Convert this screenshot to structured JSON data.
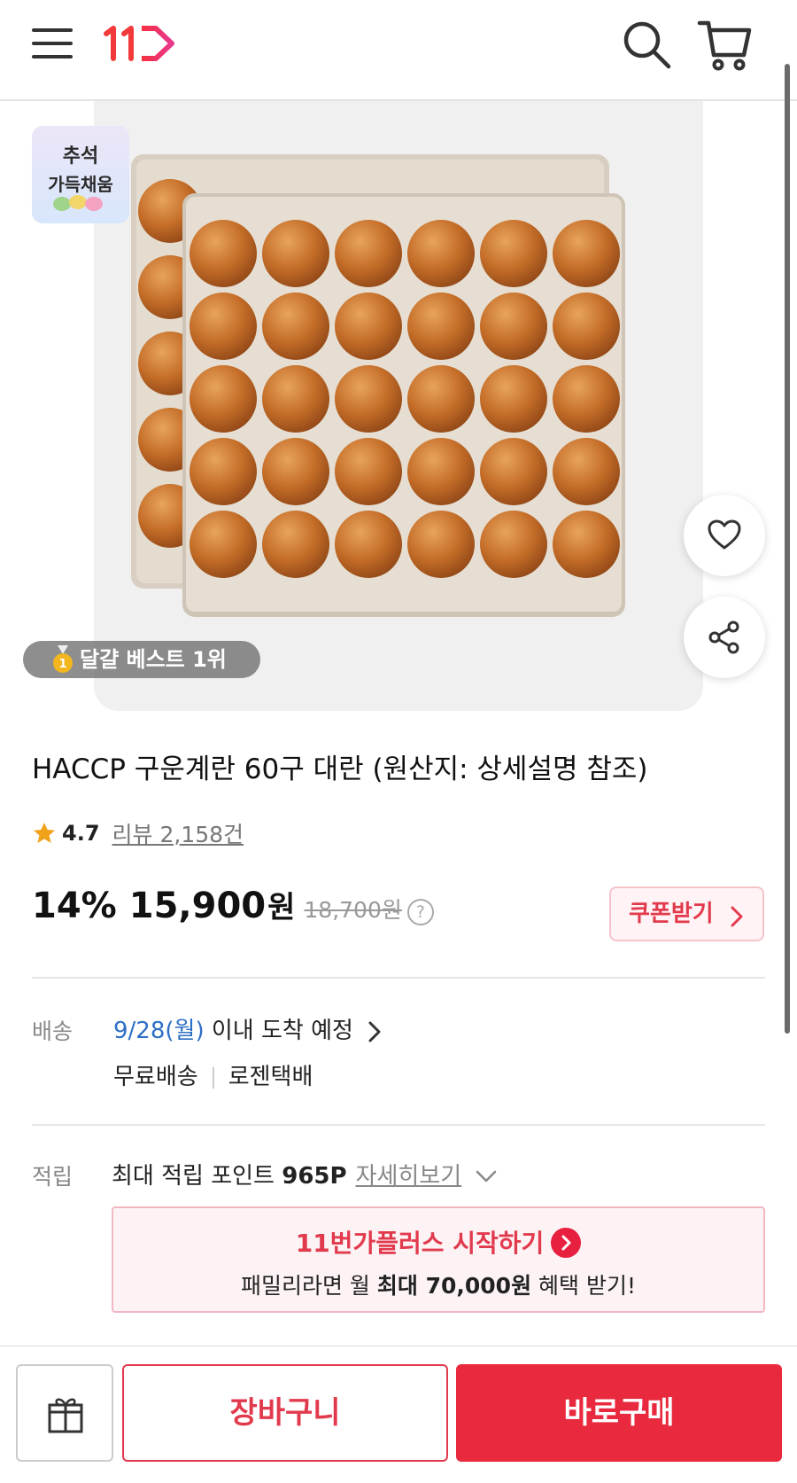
{
  "header": {
    "logo": "11",
    "menu_icon": "hamburger-menu-icon",
    "search_icon": "search-icon",
    "cart_icon": "cart-icon"
  },
  "product": {
    "event_badge": {
      "line1": "추석",
      "line2": "가득채움"
    },
    "best_badge": "달걀 베스트 1위",
    "title": "HACCP 구운계란 60구 대란 (원산지: 상세설명 참조)",
    "rating": "4.7",
    "review_text": "리뷰 2,158건",
    "discount": "14%",
    "price": "15,900",
    "price_unit": "원",
    "original_price": "18,700원",
    "help": "?",
    "coupon_label": "쿠폰받기"
  },
  "shipping": {
    "label": "배송",
    "date": "9/28(월)",
    "date_rest": " 이내 도착 예정",
    "free": "무료배송",
    "carrier": "로젠택배"
  },
  "points": {
    "label": "적립",
    "prefix": "최대 적립 포인트 ",
    "value": "965P",
    "more": "자세히보기"
  },
  "plus_promo": {
    "title": "11번가플러스 시작하기",
    "sub_prefix": "패밀리라면 월 ",
    "sub_bold": "최대 70,000원",
    "sub_suffix": " 혜택 받기!"
  },
  "bottom": {
    "gift_icon": "gift-icon",
    "cart_label": "장바구니",
    "buy_label": "바로구매"
  },
  "colors": {
    "brand_red": "#e8293e",
    "link_blue": "#2d6fc6",
    "star": "#f0a21b"
  }
}
